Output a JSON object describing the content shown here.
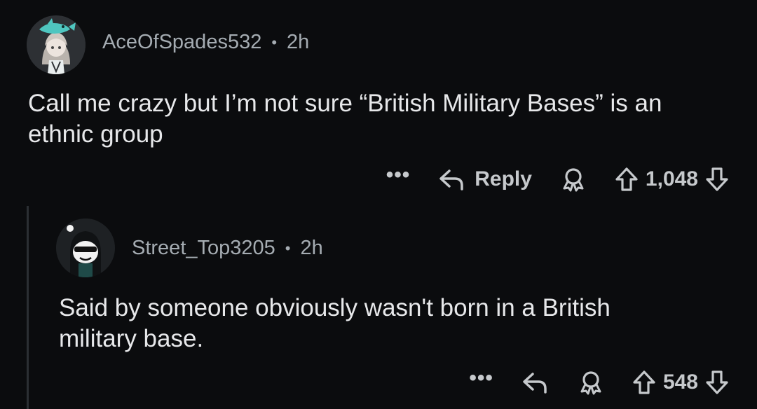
{
  "comments": [
    {
      "username": "AceOfSpades532",
      "separator": "•",
      "time": "2h",
      "body": "Call me crazy but I’m not sure “British Military Bases” is an\nethnic group",
      "more_label": "•••",
      "reply_label": "Reply",
      "score": "1,048",
      "icons": [
        "avatar",
        "more-icon",
        "reply-icon",
        "award-icon",
        "upvote-icon",
        "downvote-icon"
      ]
    },
    {
      "username": "Street_Top3205",
      "separator": "•",
      "time": "2h",
      "body": "Said by someone obviously wasn't born in a British\nmilitary base.",
      "more_label": "•••",
      "score": "548",
      "icons": [
        "avatar",
        "more-icon",
        "reply-icon",
        "award-icon",
        "upvote-icon",
        "downvote-icon"
      ]
    }
  ],
  "colors": {
    "background": "#0b0c0e",
    "text": "#e7e8ea",
    "meta": "#a5acb2",
    "thread_line": "#2b2f33"
  }
}
